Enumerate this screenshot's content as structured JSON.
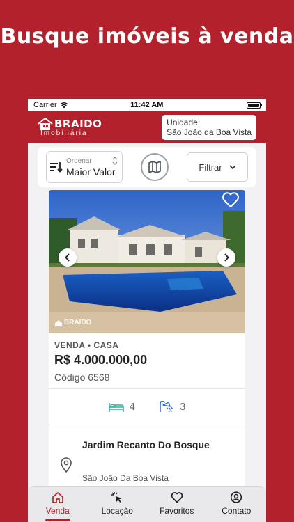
{
  "headline": "Busque imóveis à venda",
  "status_bar": {
    "carrier": "Carrier",
    "time": "11:42 AM"
  },
  "header": {
    "logo_brand": "BRAIDO",
    "logo_sub": "Imobiliária",
    "unit_label": "Unidade:",
    "unit_value": "São João da Boa Vista"
  },
  "toolbar": {
    "sort_label": "Ordenar",
    "sort_value": "Maior Valor",
    "filter_label": "Filtrar"
  },
  "listing": {
    "watermark": "BRAIDO",
    "type": "VENDA • CASA",
    "price": "R$ 4.000.000,00",
    "code": "Código 6568",
    "bedrooms": "4",
    "bathrooms": "3",
    "neighborhood": "Jardim Recanto Do Bosque",
    "city": "São João Da Boa Vista"
  },
  "tabs": [
    {
      "label": "Venda",
      "icon": "home-icon",
      "active": true
    },
    {
      "label": "Locação",
      "icon": "cursor-click-icon",
      "active": false
    },
    {
      "label": "Favoritos",
      "icon": "heart-icon",
      "active": false
    },
    {
      "label": "Contato",
      "icon": "user-circle-icon",
      "active": false
    }
  ],
  "colors": {
    "brand": "#b3222c",
    "feature_bed": "#2fb39a",
    "feature_bath": "#3a6fd1"
  }
}
